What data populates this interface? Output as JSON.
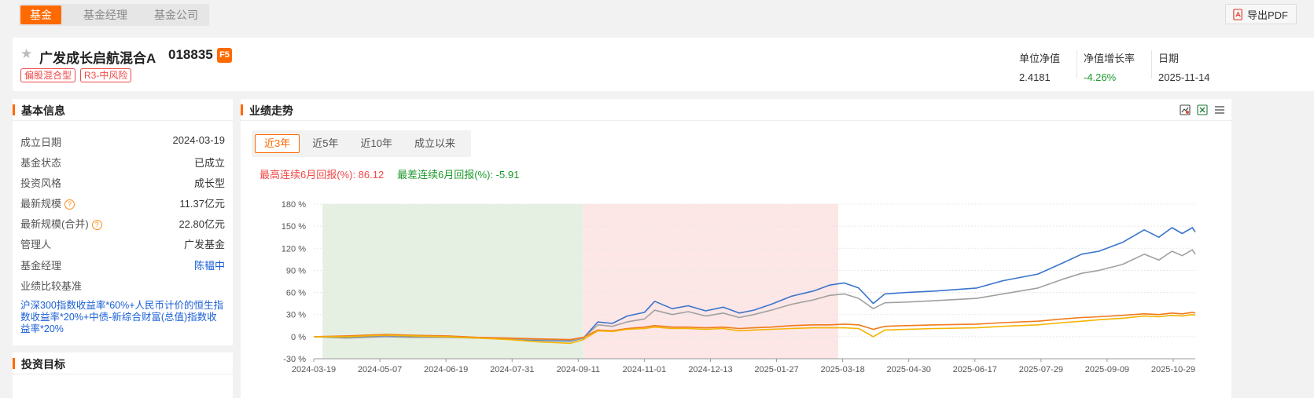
{
  "topbar": {
    "tabs": [
      "基金",
      "基金经理",
      "基金公司"
    ],
    "export_label": "导出PDF"
  },
  "fund": {
    "name": "广发成长启航混合A",
    "code": "018835",
    "badge": "F5",
    "tags": [
      "偏股混合型",
      "R3-中风险"
    ],
    "metrics": [
      {
        "label": "单位净值",
        "value": "2.4181"
      },
      {
        "label": "净值增长率",
        "value": "-4.26%"
      },
      {
        "label": "日期",
        "value": "2025-11-14"
      }
    ]
  },
  "basic_info": {
    "title": "基本信息",
    "rows": [
      {
        "key": "成立日期",
        "value": "2024-03-19"
      },
      {
        "key": "基金状态",
        "value": "已成立"
      },
      {
        "key": "投资风格",
        "value": "成长型"
      },
      {
        "key": "最新规模",
        "value": "11.37亿元"
      },
      {
        "key": "最新规模(合并)",
        "value": "22.80亿元"
      },
      {
        "key": "管理人",
        "value": "广发基金"
      },
      {
        "key": "基金经理",
        "value": "陈韫中"
      },
      {
        "key": "业绩比较基准",
        "value": ""
      }
    ],
    "benchmark": "沪深300指数收益率*60%+人民币计价的恒生指数收益率*20%+中债-新综合财富(总值)指数收益率*20%",
    "help_glyph": "?"
  },
  "invest_goal": {
    "title": "投资目标"
  },
  "performance": {
    "title": "业绩走势",
    "ranges": [
      "近3年",
      "近5年",
      "近10年",
      "成立以来"
    ],
    "best_6m": "最高连续6月回报(%): 86.12",
    "worst_6m": "最差连续6月回报(%): -5.91"
  },
  "chart_data": {
    "type": "line",
    "title": "",
    "xlabel": "",
    "ylabel": "",
    "ylim": [
      -30,
      180
    ],
    "yticks": [
      180,
      150,
      120,
      90,
      60,
      30,
      0,
      -30
    ],
    "ytick_labels": [
      "180 %",
      "150 %",
      "120 %",
      "90 %",
      "60 %",
      "30 %",
      "0 %",
      "-30 %"
    ],
    "xtick_labels": [
      "2024-03-19",
      "2024-05-07",
      "2024-06-19",
      "2024-07-31",
      "2024-09-11",
      "2024-11-01",
      "2024-12-13",
      "2025-01-27",
      "2025-03-18",
      "2025-04-30",
      "2025-06-17",
      "2025-07-29",
      "2025-09-09",
      "2025-10-29"
    ],
    "x_start": "2024-03-19",
    "x_end": "2025-11-14",
    "shaded_regions": [
      {
        "start": "2024-03-25",
        "end": "2024-09-20",
        "color": "#e5f0e3"
      },
      {
        "start": "2024-09-20",
        "end": "2025-03-14",
        "color": "#fde6e6"
      }
    ],
    "series": [
      {
        "color": "#3a74cc",
        "points": [
          [
            "2024-03-19",
            0
          ],
          [
            "2024-04-10",
            -1
          ],
          [
            "2024-05-07",
            1
          ],
          [
            "2024-05-25",
            -0.5
          ],
          [
            "2024-06-19",
            0
          ],
          [
            "2024-07-10",
            -2
          ],
          [
            "2024-07-31",
            -3
          ],
          [
            "2024-08-20",
            -5
          ],
          [
            "2024-09-11",
            -6
          ],
          [
            "2024-09-20",
            -2
          ],
          [
            "2024-09-30",
            20
          ],
          [
            "2024-10-10",
            18
          ],
          [
            "2024-10-20",
            28
          ],
          [
            "2024-11-01",
            33
          ],
          [
            "2024-11-08",
            48
          ],
          [
            "2024-11-20",
            38
          ],
          [
            "2024-12-01",
            42
          ],
          [
            "2024-12-13",
            35
          ],
          [
            "2024-12-25",
            40
          ],
          [
            "2025-01-05",
            32
          ],
          [
            "2025-01-15",
            36
          ],
          [
            "2025-01-27",
            44
          ],
          [
            "2025-02-10",
            55
          ],
          [
            "2025-02-25",
            62
          ],
          [
            "2025-03-08",
            70
          ],
          [
            "2025-03-18",
            73
          ],
          [
            "2025-03-28",
            66
          ],
          [
            "2025-04-07",
            45
          ],
          [
            "2025-04-15",
            58
          ],
          [
            "2025-04-30",
            60
          ],
          [
            "2025-05-20",
            62
          ],
          [
            "2025-06-17",
            66
          ],
          [
            "2025-07-05",
            76
          ],
          [
            "2025-07-29",
            85
          ],
          [
            "2025-08-15",
            100
          ],
          [
            "2025-08-28",
            112
          ],
          [
            "2025-09-09",
            116
          ],
          [
            "2025-09-25",
            128
          ],
          [
            "2025-10-10",
            145
          ],
          [
            "2025-10-20",
            135
          ],
          [
            "2025-10-29",
            148
          ],
          [
            "2025-11-05",
            140
          ],
          [
            "2025-11-12",
            148
          ],
          [
            "2025-11-14",
            142
          ]
        ]
      },
      {
        "color": "#a0a0a0",
        "points": [
          [
            "2024-03-19",
            0
          ],
          [
            "2024-04-10",
            -2
          ],
          [
            "2024-05-07",
            0
          ],
          [
            "2024-05-25",
            -1
          ],
          [
            "2024-06-19",
            -1
          ],
          [
            "2024-07-10",
            -2
          ],
          [
            "2024-07-31",
            -3
          ],
          [
            "2024-08-20",
            -4
          ],
          [
            "2024-09-11",
            -5
          ],
          [
            "2024-09-20",
            -2
          ],
          [
            "2024-09-30",
            16
          ],
          [
            "2024-10-10",
            14
          ],
          [
            "2024-10-20",
            20
          ],
          [
            "2024-11-01",
            24
          ],
          [
            "2024-11-08",
            36
          ],
          [
            "2024-11-20",
            30
          ],
          [
            "2024-12-01",
            34
          ],
          [
            "2024-12-13",
            28
          ],
          [
            "2024-12-25",
            32
          ],
          [
            "2025-01-05",
            26
          ],
          [
            "2025-01-15",
            30
          ],
          [
            "2025-01-27",
            36
          ],
          [
            "2025-02-10",
            44
          ],
          [
            "2025-02-25",
            50
          ],
          [
            "2025-03-08",
            56
          ],
          [
            "2025-03-18",
            58
          ],
          [
            "2025-03-28",
            52
          ],
          [
            "2025-04-07",
            38
          ],
          [
            "2025-04-15",
            46
          ],
          [
            "2025-04-30",
            47
          ],
          [
            "2025-05-20",
            49
          ],
          [
            "2025-06-17",
            52
          ],
          [
            "2025-07-05",
            58
          ],
          [
            "2025-07-29",
            66
          ],
          [
            "2025-08-15",
            78
          ],
          [
            "2025-08-28",
            86
          ],
          [
            "2025-09-09",
            90
          ],
          [
            "2025-09-25",
            98
          ],
          [
            "2025-10-10",
            112
          ],
          [
            "2025-10-20",
            104
          ],
          [
            "2025-10-29",
            116
          ],
          [
            "2025-11-05",
            110
          ],
          [
            "2025-11-12",
            118
          ],
          [
            "2025-11-14",
            112
          ]
        ]
      },
      {
        "color": "#f07a1a",
        "points": [
          [
            "2024-03-19",
            0
          ],
          [
            "2024-04-10",
            1
          ],
          [
            "2024-05-07",
            3
          ],
          [
            "2024-05-25",
            2
          ],
          [
            "2024-06-19",
            1
          ],
          [
            "2024-07-10",
            -1
          ],
          [
            "2024-07-31",
            -2
          ],
          [
            "2024-08-20",
            -3
          ],
          [
            "2024-09-11",
            -4
          ],
          [
            "2024-09-20",
            -1
          ],
          [
            "2024-09-30",
            9
          ],
          [
            "2024-10-10",
            8
          ],
          [
            "2024-10-20",
            11
          ],
          [
            "2024-11-01",
            13
          ],
          [
            "2024-11-08",
            15
          ],
          [
            "2024-11-20",
            13
          ],
          [
            "2024-12-01",
            13
          ],
          [
            "2024-12-13",
            12
          ],
          [
            "2024-12-25",
            13
          ],
          [
            "2025-01-05",
            11
          ],
          [
            "2025-01-15",
            12
          ],
          [
            "2025-01-27",
            13
          ],
          [
            "2025-02-10",
            15
          ],
          [
            "2025-02-25",
            16
          ],
          [
            "2025-03-08",
            16
          ],
          [
            "2025-03-18",
            17
          ],
          [
            "2025-03-28",
            16
          ],
          [
            "2025-04-07",
            10
          ],
          [
            "2025-04-15",
            14
          ],
          [
            "2025-04-30",
            15
          ],
          [
            "2025-05-20",
            16
          ],
          [
            "2025-06-17",
            17
          ],
          [
            "2025-07-05",
            19
          ],
          [
            "2025-07-29",
            21
          ],
          [
            "2025-08-15",
            24
          ],
          [
            "2025-08-28",
            26
          ],
          [
            "2025-09-09",
            27
          ],
          [
            "2025-09-25",
            29
          ],
          [
            "2025-10-10",
            31
          ],
          [
            "2025-10-20",
            30
          ],
          [
            "2025-10-29",
            32
          ],
          [
            "2025-11-05",
            31
          ],
          [
            "2025-11-12",
            33
          ],
          [
            "2025-11-14",
            32
          ]
        ]
      },
      {
        "color": "#f5b400",
        "points": [
          [
            "2024-03-19",
            0
          ],
          [
            "2024-04-10",
            0
          ],
          [
            "2024-05-07",
            2
          ],
          [
            "2024-05-25",
            1
          ],
          [
            "2024-06-19",
            0
          ],
          [
            "2024-07-10",
            -2
          ],
          [
            "2024-07-31",
            -4
          ],
          [
            "2024-08-20",
            -7
          ],
          [
            "2024-09-11",
            -9
          ],
          [
            "2024-09-20",
            -4
          ],
          [
            "2024-09-30",
            8
          ],
          [
            "2024-10-10",
            7
          ],
          [
            "2024-10-20",
            10
          ],
          [
            "2024-11-01",
            11
          ],
          [
            "2024-11-08",
            13
          ],
          [
            "2024-11-20",
            11
          ],
          [
            "2024-12-01",
            11
          ],
          [
            "2024-12-13",
            10
          ],
          [
            "2024-12-25",
            11
          ],
          [
            "2025-01-05",
            8
          ],
          [
            "2025-01-15",
            9
          ],
          [
            "2025-01-27",
            10
          ],
          [
            "2025-02-10",
            11
          ],
          [
            "2025-02-25",
            12
          ],
          [
            "2025-03-08",
            12
          ],
          [
            "2025-03-18",
            12
          ],
          [
            "2025-03-28",
            11
          ],
          [
            "2025-04-07",
            0
          ],
          [
            "2025-04-15",
            9
          ],
          [
            "2025-04-30",
            10
          ],
          [
            "2025-05-20",
            11
          ],
          [
            "2025-06-17",
            12
          ],
          [
            "2025-07-05",
            14
          ],
          [
            "2025-07-29",
            16
          ],
          [
            "2025-08-15",
            19
          ],
          [
            "2025-08-28",
            21
          ],
          [
            "2025-09-09",
            23
          ],
          [
            "2025-09-25",
            25
          ],
          [
            "2025-10-10",
            28
          ],
          [
            "2025-10-20",
            27
          ],
          [
            "2025-10-29",
            29
          ],
          [
            "2025-11-05",
            28
          ],
          [
            "2025-11-12",
            30
          ],
          [
            "2025-11-14",
            29
          ]
        ]
      }
    ]
  }
}
